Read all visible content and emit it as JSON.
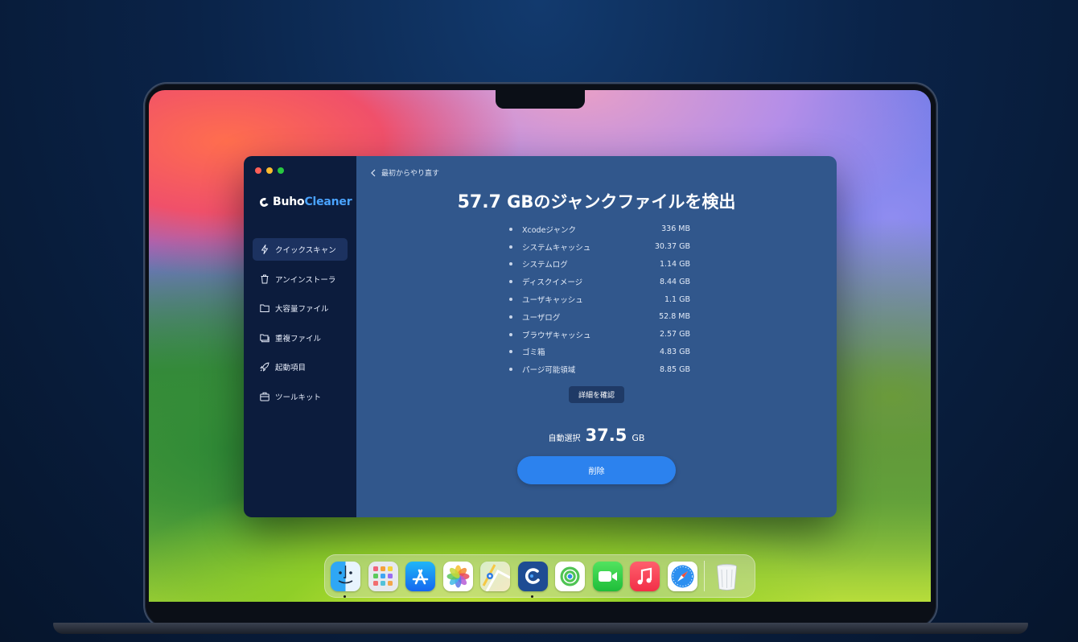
{
  "app": {
    "brand_prefix": "Buho",
    "brand_suffix": "Cleaner",
    "back_label": "最初からやり直す"
  },
  "sidebar": {
    "items": [
      {
        "label": "クイックスキャン",
        "icon": "lightning-icon",
        "active": true
      },
      {
        "label": "アンインストーラ",
        "icon": "trash-icon",
        "active": false
      },
      {
        "label": "大容量ファイル",
        "icon": "folder-icon",
        "active": false
      },
      {
        "label": "重複ファイル",
        "icon": "duplicate-folder-icon",
        "active": false
      },
      {
        "label": "起動項目",
        "icon": "rocket-icon",
        "active": false
      },
      {
        "label": "ツールキット",
        "icon": "toolkit-icon",
        "active": false
      }
    ]
  },
  "summary": {
    "total_value": "57.7",
    "total_suffix": " GBのジャンクファイルを検出"
  },
  "junk_items": [
    {
      "name": "Xcodeジャンク",
      "size": "336 MB"
    },
    {
      "name": "システムキャッシュ",
      "size": "30.37 GB"
    },
    {
      "name": "システムログ",
      "size": "1.14 GB"
    },
    {
      "name": "ディスクイメージ",
      "size": "8.44 GB"
    },
    {
      "name": "ユーザキャッシュ",
      "size": "1.1 GB"
    },
    {
      "name": "ユーザログ",
      "size": "52.8 MB"
    },
    {
      "name": "ブラウザキャッシュ",
      "size": "2.57 GB"
    },
    {
      "name": "ゴミ箱",
      "size": "4.83 GB"
    },
    {
      "name": "パージ可能領域",
      "size": "8.85 GB"
    }
  ],
  "actions": {
    "details_label": "詳細を確認",
    "auto_select_label": "自動選択",
    "auto_select_value": "37.5",
    "auto_select_unit": "GB",
    "delete_label": "削除"
  },
  "dock": {
    "apps": [
      {
        "name": "finder-icon",
        "running": true
      },
      {
        "name": "launchpad-icon",
        "running": false
      },
      {
        "name": "app-store-icon",
        "running": false
      },
      {
        "name": "photos-icon",
        "running": false
      },
      {
        "name": "maps-icon",
        "running": false
      },
      {
        "name": "buhocleaner-icon",
        "running": true
      },
      {
        "name": "find-my-icon",
        "running": false
      },
      {
        "name": "facetime-icon",
        "running": false
      },
      {
        "name": "music-icon",
        "running": false
      },
      {
        "name": "safari-icon",
        "running": false
      },
      {
        "name": "trash-icon",
        "running": false
      }
    ]
  },
  "colors": {
    "sidebar_bg": "#0c1c3d",
    "main_bg": "#31578c",
    "accent_blue": "#2c82ee",
    "brand_blue": "#4aa3ff"
  }
}
